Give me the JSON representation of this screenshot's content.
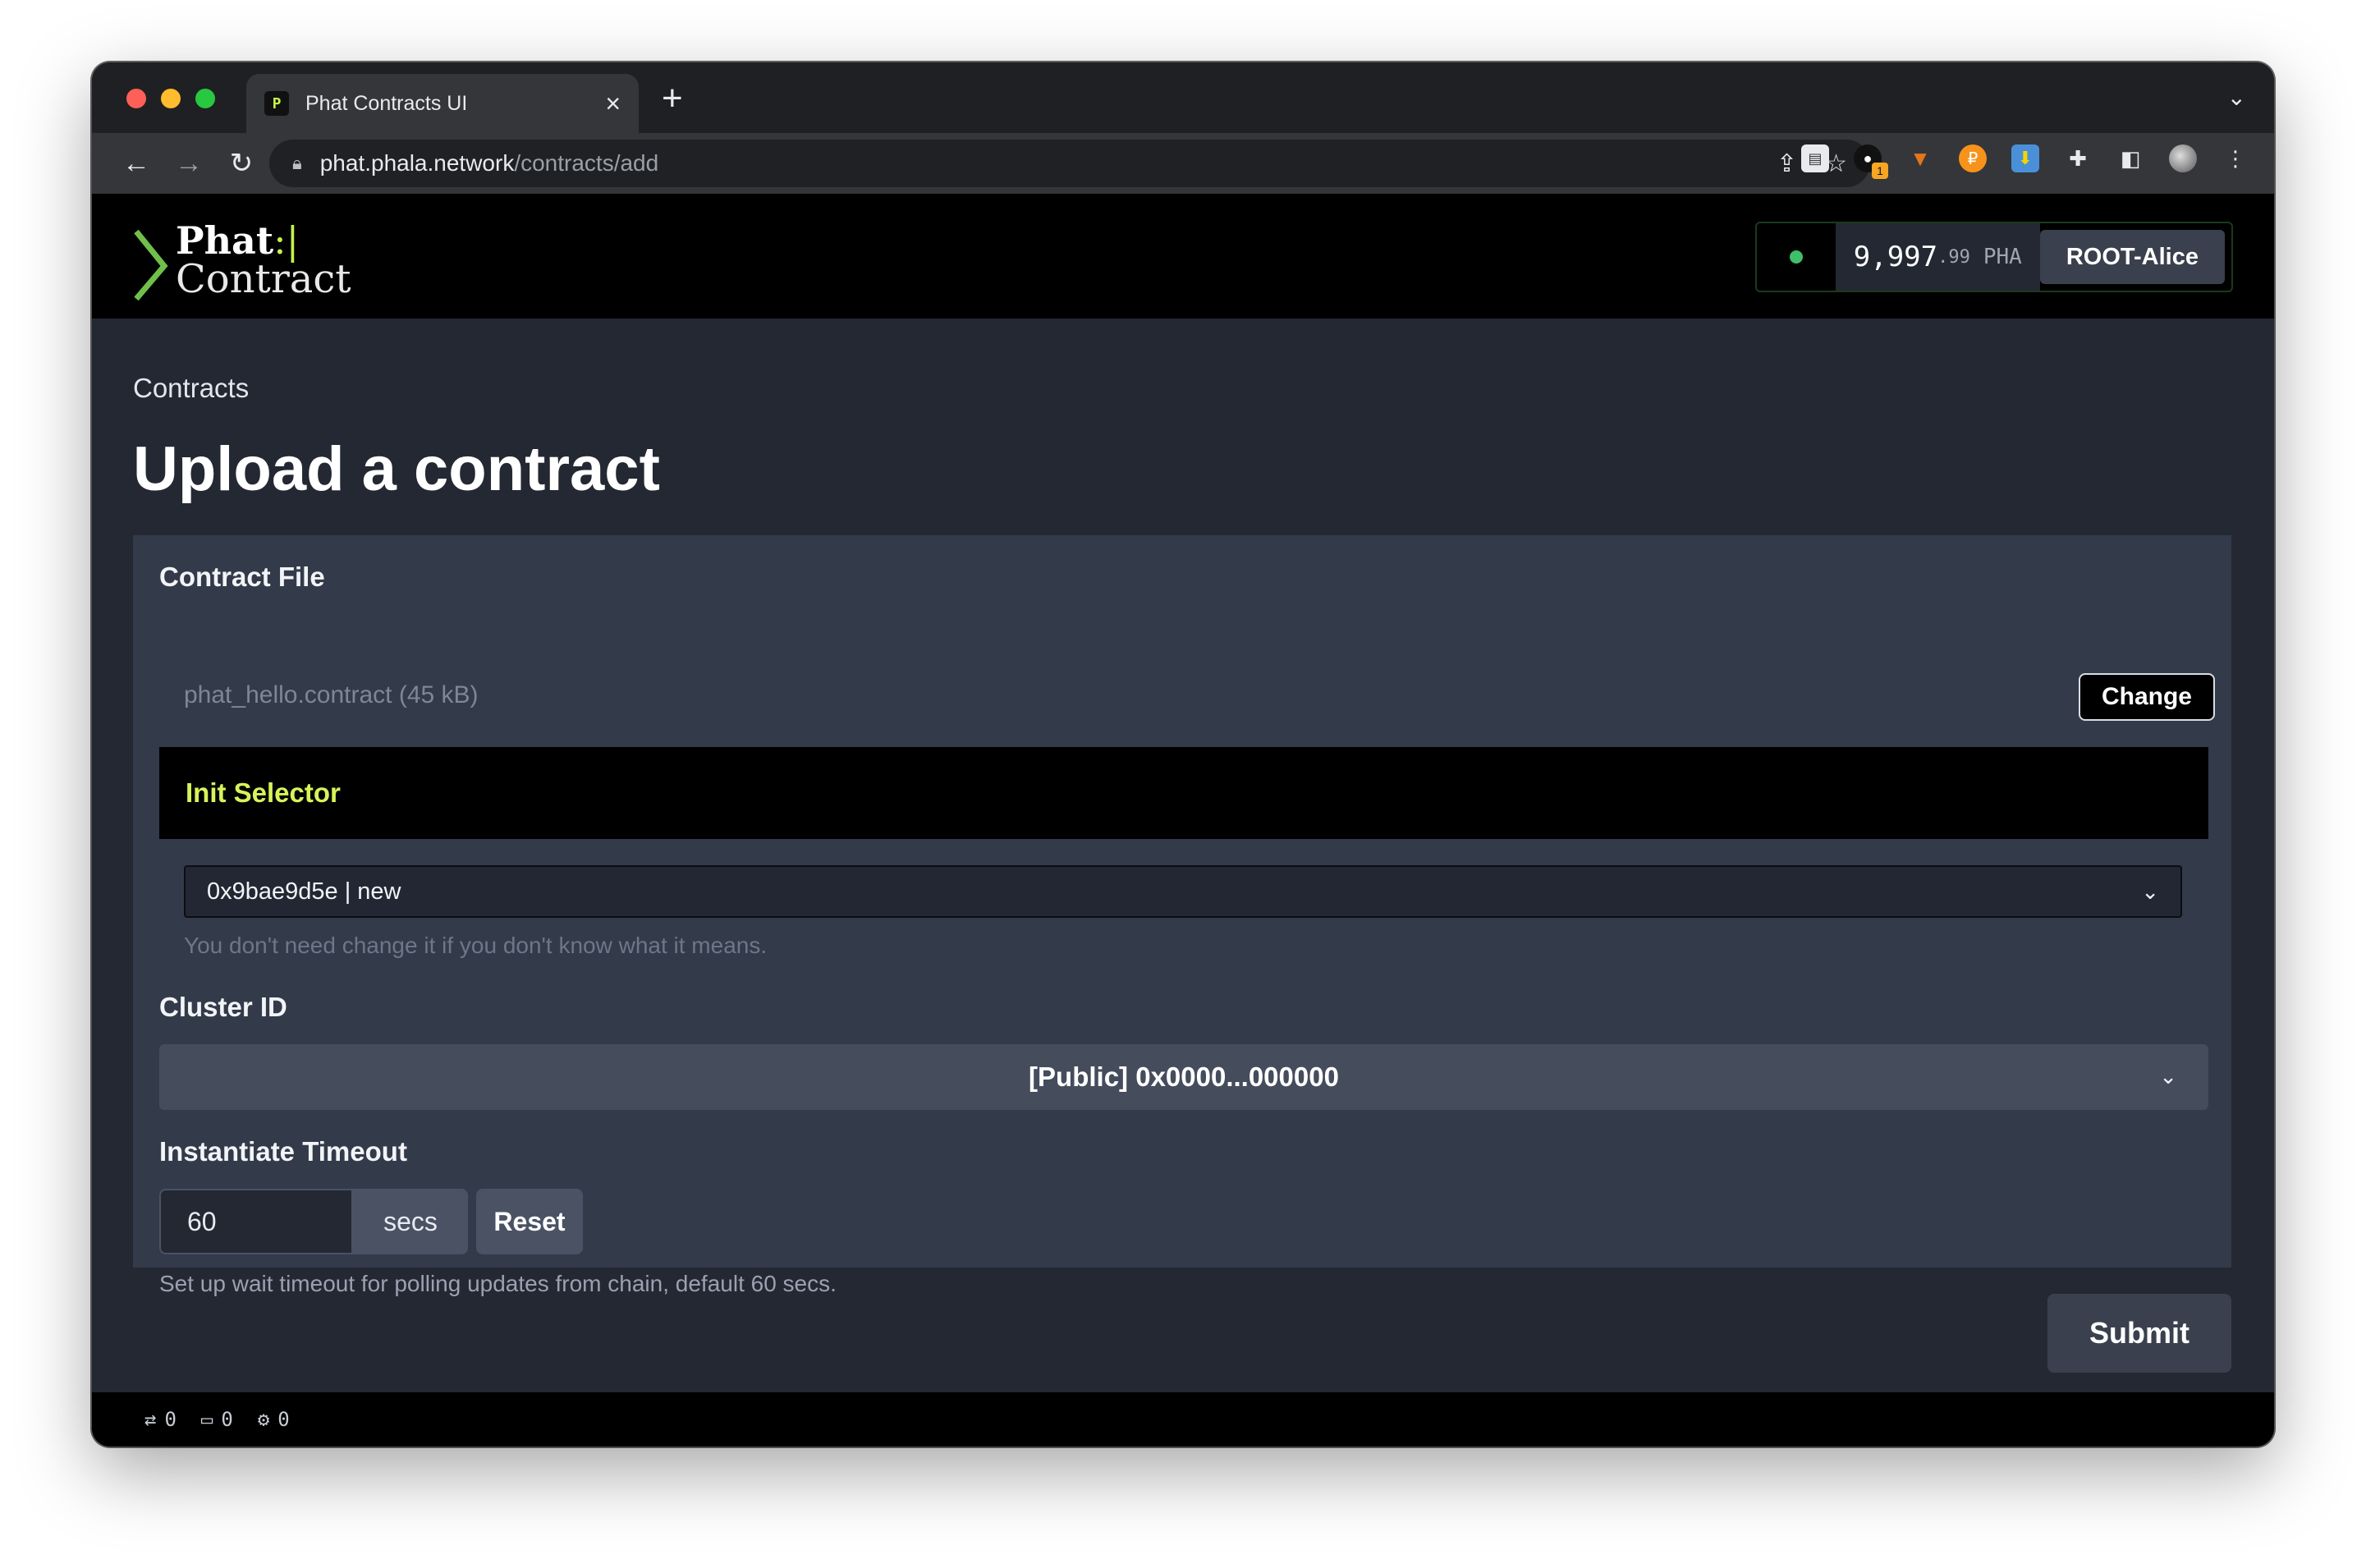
{
  "browser": {
    "tab_title": "Phat Contracts UI",
    "favicon_text": "P",
    "url_host": "phat.phala.network",
    "url_path": "/contracts/add",
    "extension_badge": "1"
  },
  "header": {
    "logo_line1": "Phat",
    "logo_line1_mark": ":|",
    "logo_line2": "Contract",
    "balance_int": "9,997",
    "balance_dec": ".99",
    "balance_unit": "PHA",
    "account_name": "ROOT-Alice",
    "status_color": "#3fbf6a"
  },
  "page": {
    "breadcrumb": "Contracts",
    "title": "Upload a contract"
  },
  "form": {
    "contract_file_label": "Contract File",
    "contract_file_name": "phat_hello.contract (45 kB)",
    "change_button": "Change",
    "init_selector_label": "Init Selector",
    "init_selector_value": "0x9bae9d5e | new",
    "init_selector_help": "You don't need change it if you don't know what it means.",
    "cluster_label": "Cluster ID",
    "cluster_value": "[Public] 0x0000...000000",
    "timeout_label": "Instantiate Timeout",
    "timeout_value": "60",
    "timeout_unit": "secs",
    "reset_button": "Reset",
    "timeout_help": "Set up wait timeout for polling updates from chain, default 60 secs.",
    "submit_button": "Submit"
  },
  "statusbar": {
    "transactions_count": "0",
    "messages_count": "0",
    "events_count": "0"
  },
  "colors": {
    "accent": "#d6f45a",
    "background": "#232833",
    "panel": "#333a4a"
  }
}
